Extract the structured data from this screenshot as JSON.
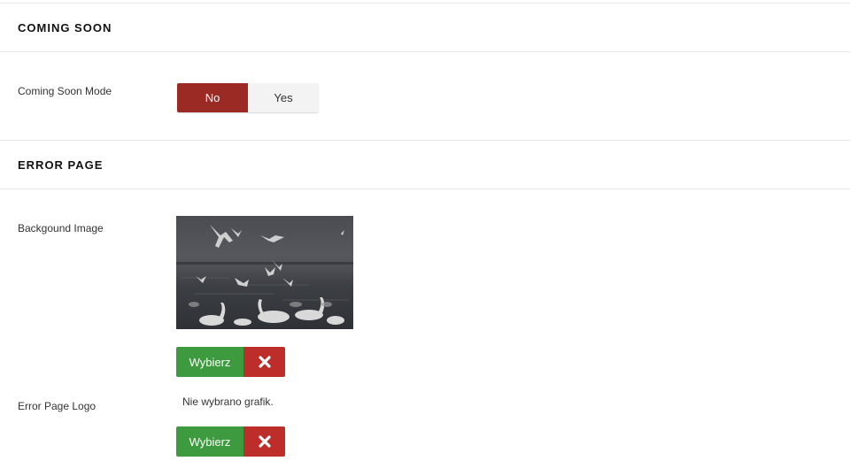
{
  "coming_soon": {
    "section_title": "COMING SOON",
    "mode_label": "Coming Soon Mode",
    "toggle": {
      "no_label": "No",
      "yes_label": "Yes",
      "selected": "No"
    }
  },
  "error_page": {
    "section_title": "ERROR PAGE",
    "background_image": {
      "label": "Backgound Image",
      "select_label": "Wybierz"
    },
    "logo": {
      "label": "Error Page Logo",
      "empty_text": "Nie wybrano grafik.",
      "select_label": "Wybierz"
    }
  },
  "colors": {
    "toggle_active": "#9b2a25",
    "select_button": "#3e9a3e",
    "clear_button": "#bd2d2a"
  },
  "icons": {
    "clear": "close-icon"
  }
}
